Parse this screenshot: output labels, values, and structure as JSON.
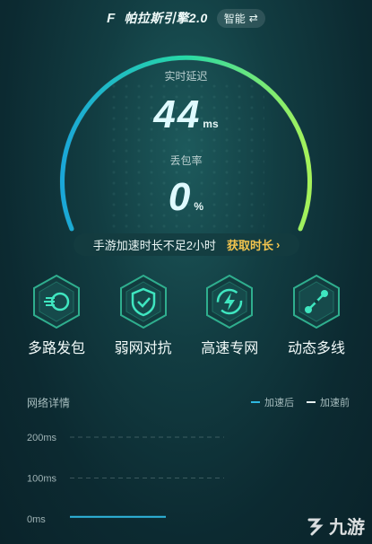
{
  "header": {
    "logo_mark": "F",
    "brand": "帕拉斯引擎2.0",
    "mode_label": "智能",
    "mode_icon": "⇄"
  },
  "gauge": {
    "latency_label": "实时延迟",
    "latency_value": "44",
    "latency_unit": "ms",
    "packet_loss_label": "丢包率",
    "packet_loss_value": "0",
    "packet_loss_unit": "%",
    "accent_start": "#1aa7d8",
    "accent_end": "#a6f25a"
  },
  "promo": {
    "text": "手游加速时长不足2小时",
    "action_label": "获取时长",
    "action_icon": "›",
    "action_color": "#f2c44e"
  },
  "features": [
    {
      "label": "多路发包",
      "icon": "multipath-icon"
    },
    {
      "label": "弱网对抗",
      "icon": "shield-check-icon"
    },
    {
      "label": "高速专网",
      "icon": "lightning-icon"
    },
    {
      "label": "动态多线",
      "icon": "dynamic-line-icon"
    }
  ],
  "details": {
    "title": "网络详情",
    "legend_after": "加速后",
    "legend_before": "加速前",
    "after_color": "#2fb8e0",
    "before_color": "#e6f0f0"
  },
  "chart_data": {
    "type": "line",
    "title": "",
    "xlabel": "",
    "ylabel": "",
    "y_ticks": [
      "200ms",
      "100ms",
      "0ms"
    ],
    "ylim": [
      0,
      200
    ],
    "series": [
      {
        "name": "加速后",
        "values": [
          5,
          5,
          5,
          5,
          5,
          5
        ]
      },
      {
        "name": "加速前",
        "values": []
      }
    ],
    "grid": true,
    "legend_position": "top-right"
  },
  "watermark": {
    "text": "九游"
  }
}
